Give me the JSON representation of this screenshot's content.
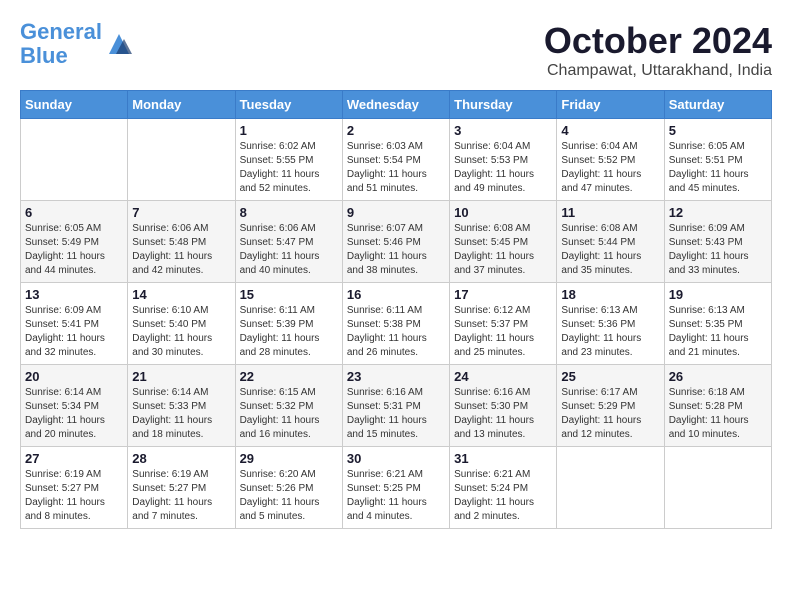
{
  "header": {
    "logo_line1": "General",
    "logo_line2": "Blue",
    "month": "October 2024",
    "location": "Champawat, Uttarakhand, India"
  },
  "weekdays": [
    "Sunday",
    "Monday",
    "Tuesday",
    "Wednesday",
    "Thursday",
    "Friday",
    "Saturday"
  ],
  "weeks": [
    [
      {
        "day": "",
        "info": ""
      },
      {
        "day": "",
        "info": ""
      },
      {
        "day": "1",
        "info": "Sunrise: 6:02 AM\nSunset: 5:55 PM\nDaylight: 11 hours and 52 minutes."
      },
      {
        "day": "2",
        "info": "Sunrise: 6:03 AM\nSunset: 5:54 PM\nDaylight: 11 hours and 51 minutes."
      },
      {
        "day": "3",
        "info": "Sunrise: 6:04 AM\nSunset: 5:53 PM\nDaylight: 11 hours and 49 minutes."
      },
      {
        "day": "4",
        "info": "Sunrise: 6:04 AM\nSunset: 5:52 PM\nDaylight: 11 hours and 47 minutes."
      },
      {
        "day": "5",
        "info": "Sunrise: 6:05 AM\nSunset: 5:51 PM\nDaylight: 11 hours and 45 minutes."
      }
    ],
    [
      {
        "day": "6",
        "info": "Sunrise: 6:05 AM\nSunset: 5:49 PM\nDaylight: 11 hours and 44 minutes."
      },
      {
        "day": "7",
        "info": "Sunrise: 6:06 AM\nSunset: 5:48 PM\nDaylight: 11 hours and 42 minutes."
      },
      {
        "day": "8",
        "info": "Sunrise: 6:06 AM\nSunset: 5:47 PM\nDaylight: 11 hours and 40 minutes."
      },
      {
        "day": "9",
        "info": "Sunrise: 6:07 AM\nSunset: 5:46 PM\nDaylight: 11 hours and 38 minutes."
      },
      {
        "day": "10",
        "info": "Sunrise: 6:08 AM\nSunset: 5:45 PM\nDaylight: 11 hours and 37 minutes."
      },
      {
        "day": "11",
        "info": "Sunrise: 6:08 AM\nSunset: 5:44 PM\nDaylight: 11 hours and 35 minutes."
      },
      {
        "day": "12",
        "info": "Sunrise: 6:09 AM\nSunset: 5:43 PM\nDaylight: 11 hours and 33 minutes."
      }
    ],
    [
      {
        "day": "13",
        "info": "Sunrise: 6:09 AM\nSunset: 5:41 PM\nDaylight: 11 hours and 32 minutes."
      },
      {
        "day": "14",
        "info": "Sunrise: 6:10 AM\nSunset: 5:40 PM\nDaylight: 11 hours and 30 minutes."
      },
      {
        "day": "15",
        "info": "Sunrise: 6:11 AM\nSunset: 5:39 PM\nDaylight: 11 hours and 28 minutes."
      },
      {
        "day": "16",
        "info": "Sunrise: 6:11 AM\nSunset: 5:38 PM\nDaylight: 11 hours and 26 minutes."
      },
      {
        "day": "17",
        "info": "Sunrise: 6:12 AM\nSunset: 5:37 PM\nDaylight: 11 hours and 25 minutes."
      },
      {
        "day": "18",
        "info": "Sunrise: 6:13 AM\nSunset: 5:36 PM\nDaylight: 11 hours and 23 minutes."
      },
      {
        "day": "19",
        "info": "Sunrise: 6:13 AM\nSunset: 5:35 PM\nDaylight: 11 hours and 21 minutes."
      }
    ],
    [
      {
        "day": "20",
        "info": "Sunrise: 6:14 AM\nSunset: 5:34 PM\nDaylight: 11 hours and 20 minutes."
      },
      {
        "day": "21",
        "info": "Sunrise: 6:14 AM\nSunset: 5:33 PM\nDaylight: 11 hours and 18 minutes."
      },
      {
        "day": "22",
        "info": "Sunrise: 6:15 AM\nSunset: 5:32 PM\nDaylight: 11 hours and 16 minutes."
      },
      {
        "day": "23",
        "info": "Sunrise: 6:16 AM\nSunset: 5:31 PM\nDaylight: 11 hours and 15 minutes."
      },
      {
        "day": "24",
        "info": "Sunrise: 6:16 AM\nSunset: 5:30 PM\nDaylight: 11 hours and 13 minutes."
      },
      {
        "day": "25",
        "info": "Sunrise: 6:17 AM\nSunset: 5:29 PM\nDaylight: 11 hours and 12 minutes."
      },
      {
        "day": "26",
        "info": "Sunrise: 6:18 AM\nSunset: 5:28 PM\nDaylight: 11 hours and 10 minutes."
      }
    ],
    [
      {
        "day": "27",
        "info": "Sunrise: 6:19 AM\nSunset: 5:27 PM\nDaylight: 11 hours and 8 minutes."
      },
      {
        "day": "28",
        "info": "Sunrise: 6:19 AM\nSunset: 5:27 PM\nDaylight: 11 hours and 7 minutes."
      },
      {
        "day": "29",
        "info": "Sunrise: 6:20 AM\nSunset: 5:26 PM\nDaylight: 11 hours and 5 minutes."
      },
      {
        "day": "30",
        "info": "Sunrise: 6:21 AM\nSunset: 5:25 PM\nDaylight: 11 hours and 4 minutes."
      },
      {
        "day": "31",
        "info": "Sunrise: 6:21 AM\nSunset: 5:24 PM\nDaylight: 11 hours and 2 minutes."
      },
      {
        "day": "",
        "info": ""
      },
      {
        "day": "",
        "info": ""
      }
    ]
  ]
}
